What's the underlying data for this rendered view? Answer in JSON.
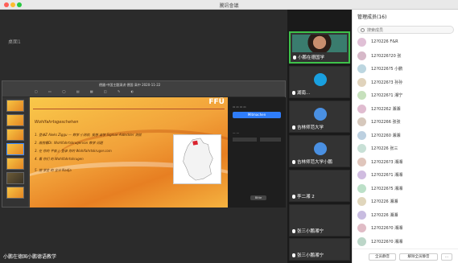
{
  "window": {
    "title": "騰訊會議"
  },
  "stage": {
    "label": "桌面1",
    "share_title": "德國·中国主题演讲 德国 高中 2020-11-22",
    "slide": {
      "brand": "FFÜ",
      "title": "Wohlfahrtsgeschehen",
      "items": [
        "1. 登录Z Aleks Ziggu — 数学 小测验, 我想 请学 Sigmar Aldeckler 测验",
        "2. 画图看Dr. Wohlfahrtskrugervon 数学 问题 ",
        "3. 在 你的 平板上 登录 你的 Wohlfahrtskruger.com",
        "4. 看 你们 的 Wohlfahrtskrugen",
        "5. 把 学生 的 全分 Nadja"
      ],
      "panel_button": "Mitmachen",
      "panel_ok": "Bitte"
    },
    "bottom_name": "小鹏在德国小鹏德语教学"
  },
  "videos": [
    {
      "name": "小鹏在德国学",
      "active": true,
      "kind": "face"
    },
    {
      "name": "湖南...",
      "active": false,
      "kind": "avatar",
      "color": "#19a0e0"
    },
    {
      "name": "吉林师范大学",
      "active": false,
      "kind": "avatar",
      "color": "#4a90e2"
    },
    {
      "name": "吉林师范大学小鹏",
      "active": false,
      "kind": "avatar",
      "color": "#4a90e2"
    },
    {
      "name": "李二湘 2",
      "active": false,
      "kind": "blank"
    },
    {
      "name": "张三小鹏湘宁",
      "active": false,
      "kind": "blank"
    },
    {
      "name": "张三小鹏湘宁",
      "active": false,
      "kind": "blank"
    }
  ],
  "participants": {
    "header": "管理成员(16)",
    "search_placeholder": "搜索成员",
    "rows": [
      {
        "name": "12?0226 F&R",
        "color": "#e0c0d6"
      },
      {
        "name": "12?0226?20 张",
        "color": "#d6b8c8"
      },
      {
        "name": "12?0226?5 小鹏",
        "color": "#bcd6e0"
      },
      {
        "name": "12?0226?3 孙孙",
        "color": "#e0d3bc"
      },
      {
        "name": "12?0226?1 湘宁",
        "color": "#c6e0bc"
      },
      {
        "name": "12?02262 湘湘",
        "color": "#e0bcd0"
      },
      {
        "name": "12?02266 张张",
        "color": "#d6c8bc"
      },
      {
        "name": "12?02260 湘湘",
        "color": "#bcd0e0"
      },
      {
        "name": "12?0226 张三",
        "color": "#c8e0d6"
      },
      {
        "name": "12?0226?3 湘湘",
        "color": "#e0c6bc"
      },
      {
        "name": "12?0226?1 湘湘",
        "color": "#d0bce0"
      },
      {
        "name": "12?0226?5 湘湘",
        "color": "#bce0c8"
      },
      {
        "name": "12?0226 湘湘",
        "color": "#e0d6bc"
      },
      {
        "name": "12?0226 湘湘",
        "color": "#c8bce0"
      },
      {
        "name": "12?0226?0 湘湘",
        "color": "#e0bcc6"
      },
      {
        "name": "12?0226?0 湘湘",
        "color": "#bcd6c8"
      }
    ],
    "footer_left": "全员静音",
    "footer_right": "解除全员静音",
    "footer_more": "..."
  }
}
